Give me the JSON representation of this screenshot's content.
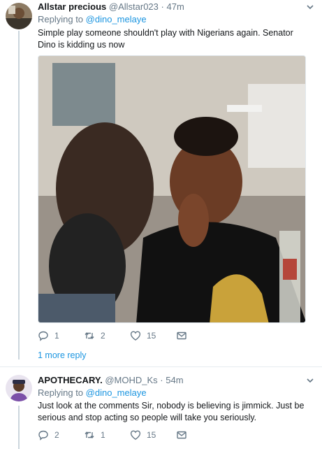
{
  "tweet1": {
    "name": "Allstar precious",
    "handle": "@Allstar023",
    "separator": "·",
    "time": "47m",
    "replying_prefix": "Replying to",
    "replying_to": "@dino_melaye",
    "text": "Simple play someone shouldn't play with Nigerians again. Senator Dino is kidding us now",
    "replies": "1",
    "retweets": "2",
    "likes": "15"
  },
  "more_replies": "1 more reply",
  "tweet2": {
    "name": "APOTHECARY.",
    "handle": "@MOHD_Ks",
    "separator": "·",
    "time": "54m",
    "replying_prefix": "Replying to",
    "replying_to": "@dino_melaye",
    "text": "Just look at the comments Sir, nobody is believing is jimmick. Just be serious and stop acting so people will take you seriously.",
    "replies": "2",
    "retweets": "1",
    "likes": "15"
  },
  "icons": {
    "reply": "reply-icon",
    "retweet": "retweet-icon",
    "like": "heart-icon",
    "dm": "envelope-icon",
    "caret": "chevron-down-icon"
  },
  "colors": {
    "link": "#1b95e0",
    "secondary_text": "#657786",
    "thread_line": "#ccd6dd",
    "divider": "#e6ecf0"
  }
}
